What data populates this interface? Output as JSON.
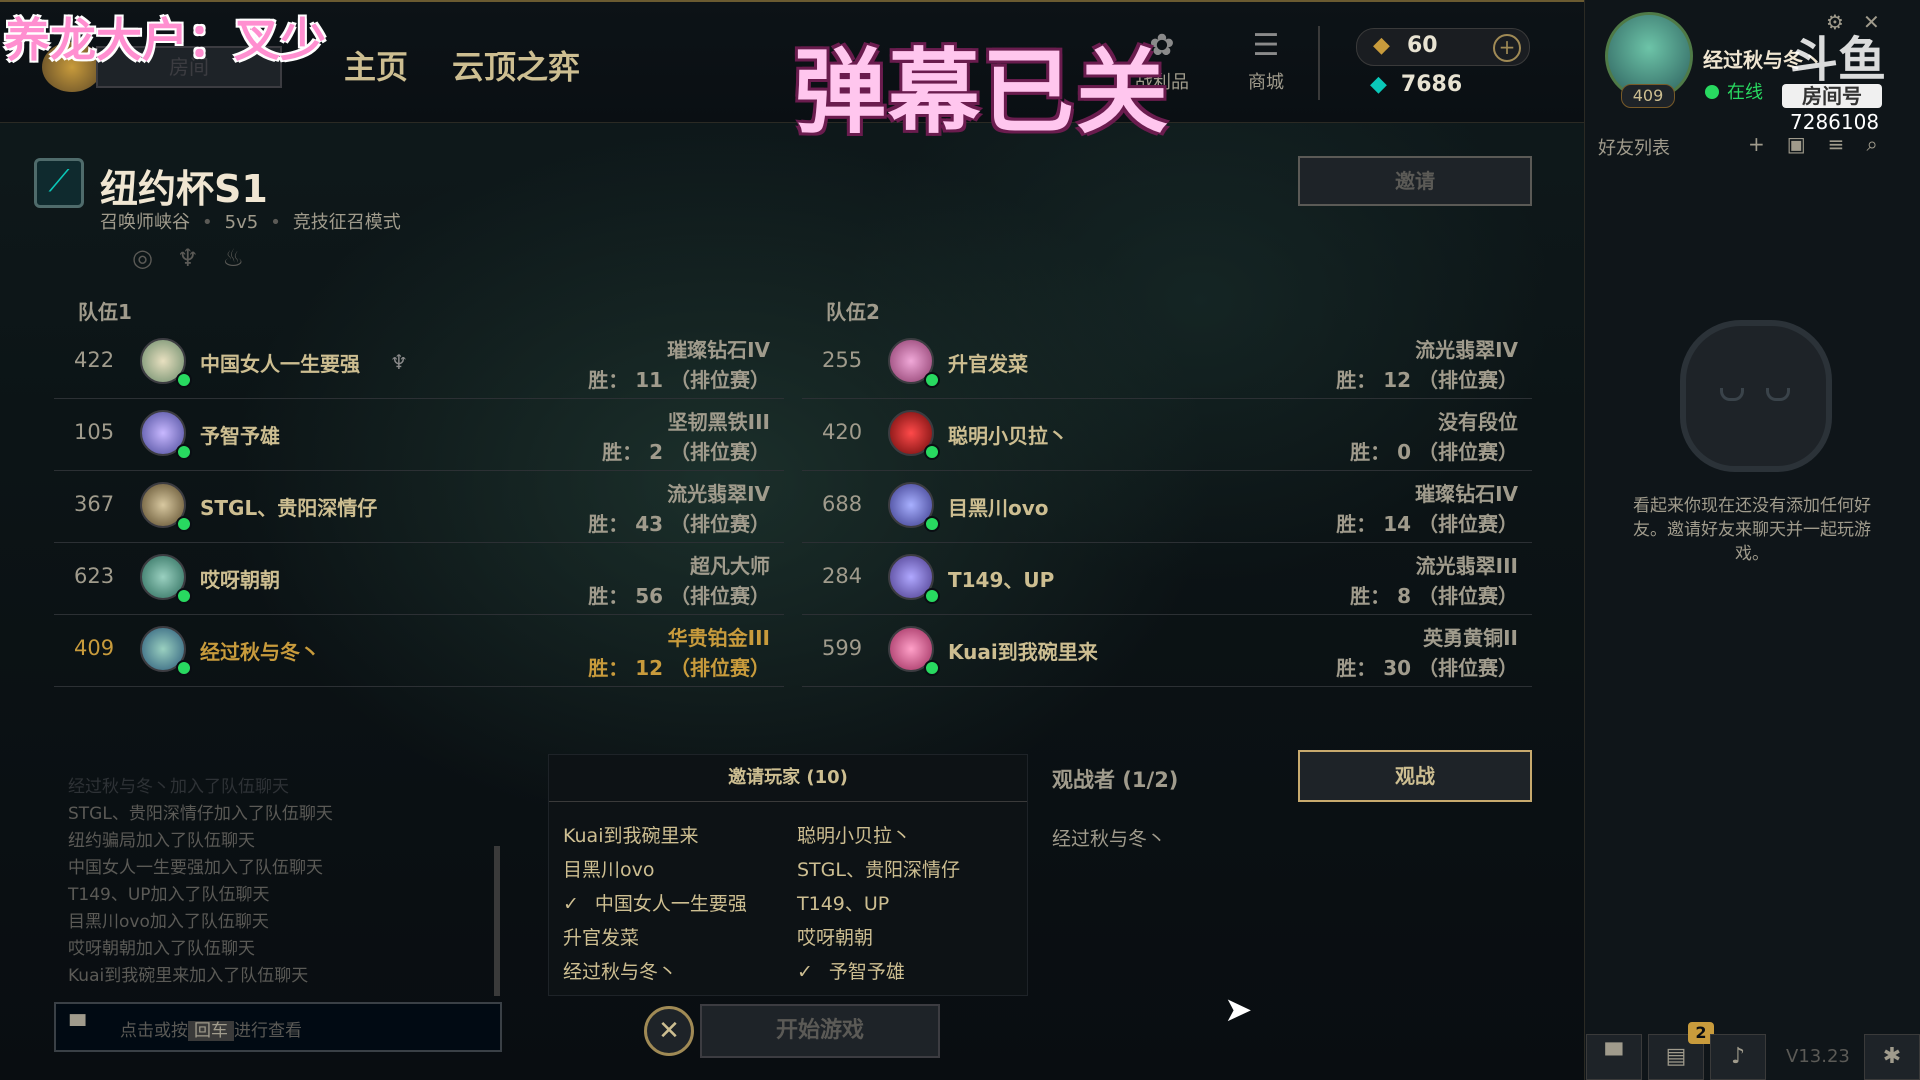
{
  "overlay": {
    "streamer_text": "养龙大户：叉少",
    "danmu_text": "弹幕已关"
  },
  "topbar": {
    "room_button": "房间",
    "nav": [
      "主页",
      "云顶之弈"
    ],
    "loot_label": "战利品",
    "store_label": "商城",
    "rp": "60",
    "be": "7686"
  },
  "summoner": {
    "name": "经过秋与冬丶",
    "status": "在线",
    "level": "409"
  },
  "douyu": {
    "logo": "斗鱼",
    "room_tag": "房间号",
    "room_number": "7286108"
  },
  "social": {
    "title": "好友列表",
    "empty_message": "看起来你现在还没有添加任何好友。邀请好友来聊天并一起玩游戏。",
    "version": "V13.23",
    "notif_count": "2"
  },
  "lobby": {
    "title": "纽约杯S1",
    "map": "召唤师峡谷",
    "size": "5v5",
    "mode": "竞技征召模式",
    "invite_button": "邀请",
    "team1_label": "队伍1",
    "team2_label": "队伍2",
    "team1": [
      {
        "level": "422",
        "name": "中国女人一生要强",
        "rank": "璀璨钻石IV",
        "wins": "胜：  11  （排位赛）"
      },
      {
        "level": "105",
        "name": "予智予雄",
        "rank": "坚韧黑铁III",
        "wins": "胜：  2  （排位赛）"
      },
      {
        "level": "367",
        "name": "STGL、贵阳深情仔",
        "rank": "流光翡翠IV",
        "wins": "胜：  43  （排位赛）"
      },
      {
        "level": "623",
        "name": "哎呀朝朝",
        "rank": "超凡大师",
        "wins": "胜：  56  （排位赛）"
      },
      {
        "level": "409",
        "name": "经过秋与冬丶",
        "rank": "华贵铂金III",
        "wins": "胜：  12  （排位赛）"
      }
    ],
    "team2": [
      {
        "level": "255",
        "name": "升官发菜",
        "rank": "流光翡翠IV",
        "wins": "胜：  12  （排位赛）"
      },
      {
        "level": "420",
        "name": "聪明小贝拉丶",
        "rank": "没有段位",
        "wins": "胜：  0  （排位赛）"
      },
      {
        "level": "688",
        "name": "目黑川ovo",
        "rank": "璀璨钻石IV",
        "wins": "胜：  14  （排位赛）"
      },
      {
        "level": "284",
        "name": "T149、UP",
        "rank": "流光翡翠III",
        "wins": "胜：  8  （排位赛）"
      },
      {
        "level": "599",
        "name": "Kuai到我碗里来",
        "rank": "英勇黄铜II",
        "wins": "胜：  30  （排位赛）"
      }
    ],
    "chat": [
      "经过秋与冬丶加入了队伍聊天",
      "STGL、贵阳深情仔加入了队伍聊天",
      "纽约骗局加入了队伍聊天",
      "中国女人一生要强加入了队伍聊天",
      "T149、UP加入了队伍聊天",
      "目黑川ovo加入了队伍聊天",
      "哎呀朝朝加入了队伍聊天",
      "Kuai到我碗里来加入了队伍聊天"
    ],
    "chat_placeholder_pre": "点击或按",
    "chat_placeholder_key": "回车",
    "chat_placeholder_post": "进行查看",
    "invite_panel_title": "邀请玩家 (10)",
    "invited": [
      {
        "name": "Kuai到我碗里来",
        "checked": false
      },
      {
        "name": "聪明小贝拉丶",
        "checked": false
      },
      {
        "name": "目黑川ovo",
        "checked": false
      },
      {
        "name": "STGL、贵阳深情仔",
        "checked": false
      },
      {
        "name": "中国女人一生要强",
        "checked": true
      },
      {
        "name": "T149、UP",
        "checked": false
      },
      {
        "name": "升官发菜",
        "checked": false
      },
      {
        "name": "哎呀朝朝",
        "checked": false
      },
      {
        "name": "经过秋与冬丶",
        "checked": false
      },
      {
        "name": "予智予雄",
        "checked": true
      }
    ],
    "spectators_title": "观战者 (1/2)",
    "spectator": "经过秋与冬丶",
    "spectate_button": "观战",
    "start_button": "开始游戏"
  },
  "colors": {
    "gold": "#c89b3c",
    "online": "#28d960",
    "text": "#a09b8c"
  }
}
